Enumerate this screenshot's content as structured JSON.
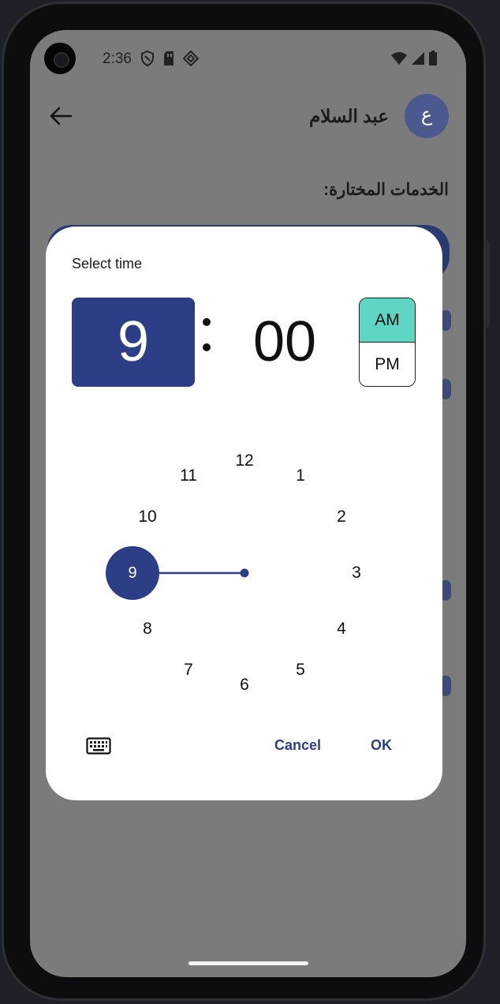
{
  "status_bar": {
    "time": "2:36",
    "left_icons": [
      "shield-icon",
      "sd-card-icon",
      "diamond-icon"
    ],
    "right_icons": [
      "wifi-icon",
      "signal-icon",
      "battery-icon"
    ]
  },
  "app_bar": {
    "back_icon": "arrow-left-icon",
    "user_name": "عبد السلام",
    "avatar_letter": "ع"
  },
  "page": {
    "services_label": "الخدمات المختارة:"
  },
  "time_picker": {
    "title": "Select time",
    "hour": "9",
    "minute": "00",
    "am_label": "AM",
    "pm_label": "PM",
    "selected_period": "AM",
    "selected_hour": 9,
    "dial_numbers": [
      "12",
      "1",
      "2",
      "3",
      "4",
      "5",
      "6",
      "7",
      "8",
      "9",
      "10",
      "11"
    ],
    "cancel_label": "Cancel",
    "ok_label": "OK",
    "keyboard_icon": "keyboard-icon"
  },
  "colors": {
    "primary": "#2b3e86",
    "am_selected": "#5fd6c3",
    "scrim": "#7b7b7b"
  }
}
